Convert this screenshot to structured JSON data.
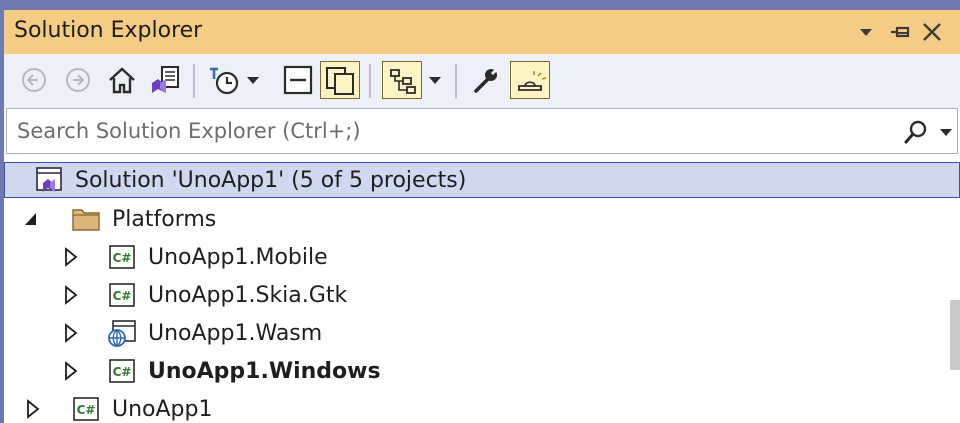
{
  "window": {
    "title": "Solution Explorer"
  },
  "title_buttons": [
    "window-position-icon",
    "pin-icon",
    "close-icon"
  ],
  "toolbar": {
    "items": [
      "back-icon",
      "forward-icon",
      "home-icon",
      "switch-views-icon",
      "pending-changes-filter-icon",
      "collapse-all-icon",
      "show-all-files-icon",
      "sync-with-active-document-icon",
      "properties-icon",
      "preview-selected-items-icon"
    ]
  },
  "search": {
    "placeholder": "Search Solution Explorer (Ctrl+;)",
    "value": ""
  },
  "tree": {
    "solution_label": "Solution 'UnoApp1' (5 of 5 projects)",
    "platforms_label": "Platforms",
    "mobile_label": "UnoApp1.Mobile",
    "skia_label": "UnoApp1.Skia.Gtk",
    "wasm_label": "UnoApp1.Wasm",
    "windows_label": "UnoApp1.Windows",
    "unoapp_label": "UnoApp1"
  },
  "colors": {
    "title_bar": "#f5cc84",
    "toolbar": "#eef0f7",
    "selection": "#cfd8f0",
    "selection_border": "#3f4fa8",
    "csharp_green": "#2f7a30",
    "vs_purple": "#6a3fc0"
  }
}
